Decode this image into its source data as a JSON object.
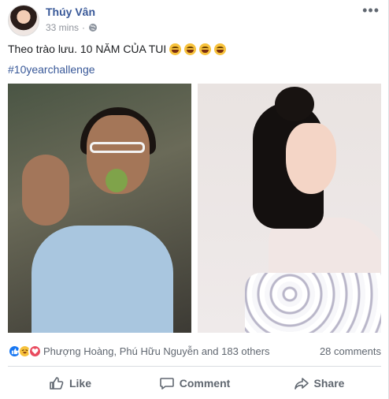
{
  "post": {
    "author": "Thúy Vân",
    "time": "33 mins",
    "privacy_icon": "globe-icon",
    "status_text": "Theo trào lưu. 10 NĂM CỦA TUI",
    "emoji_count": 4,
    "hashtag": "#10yearchallenge",
    "photos": [
      "left photo",
      "right photo"
    ]
  },
  "reactions": {
    "icons": [
      "like-icon",
      "haha-icon",
      "love-icon"
    ],
    "names": "Phượng Hoàng, Phú Hữu Nguyễn and 183 others",
    "comments": "28 comments"
  },
  "actions": {
    "like": "Like",
    "comment": "Comment",
    "share": "Share"
  },
  "colors": {
    "link": "#385898",
    "meta": "#90949c",
    "action": "#606770"
  }
}
